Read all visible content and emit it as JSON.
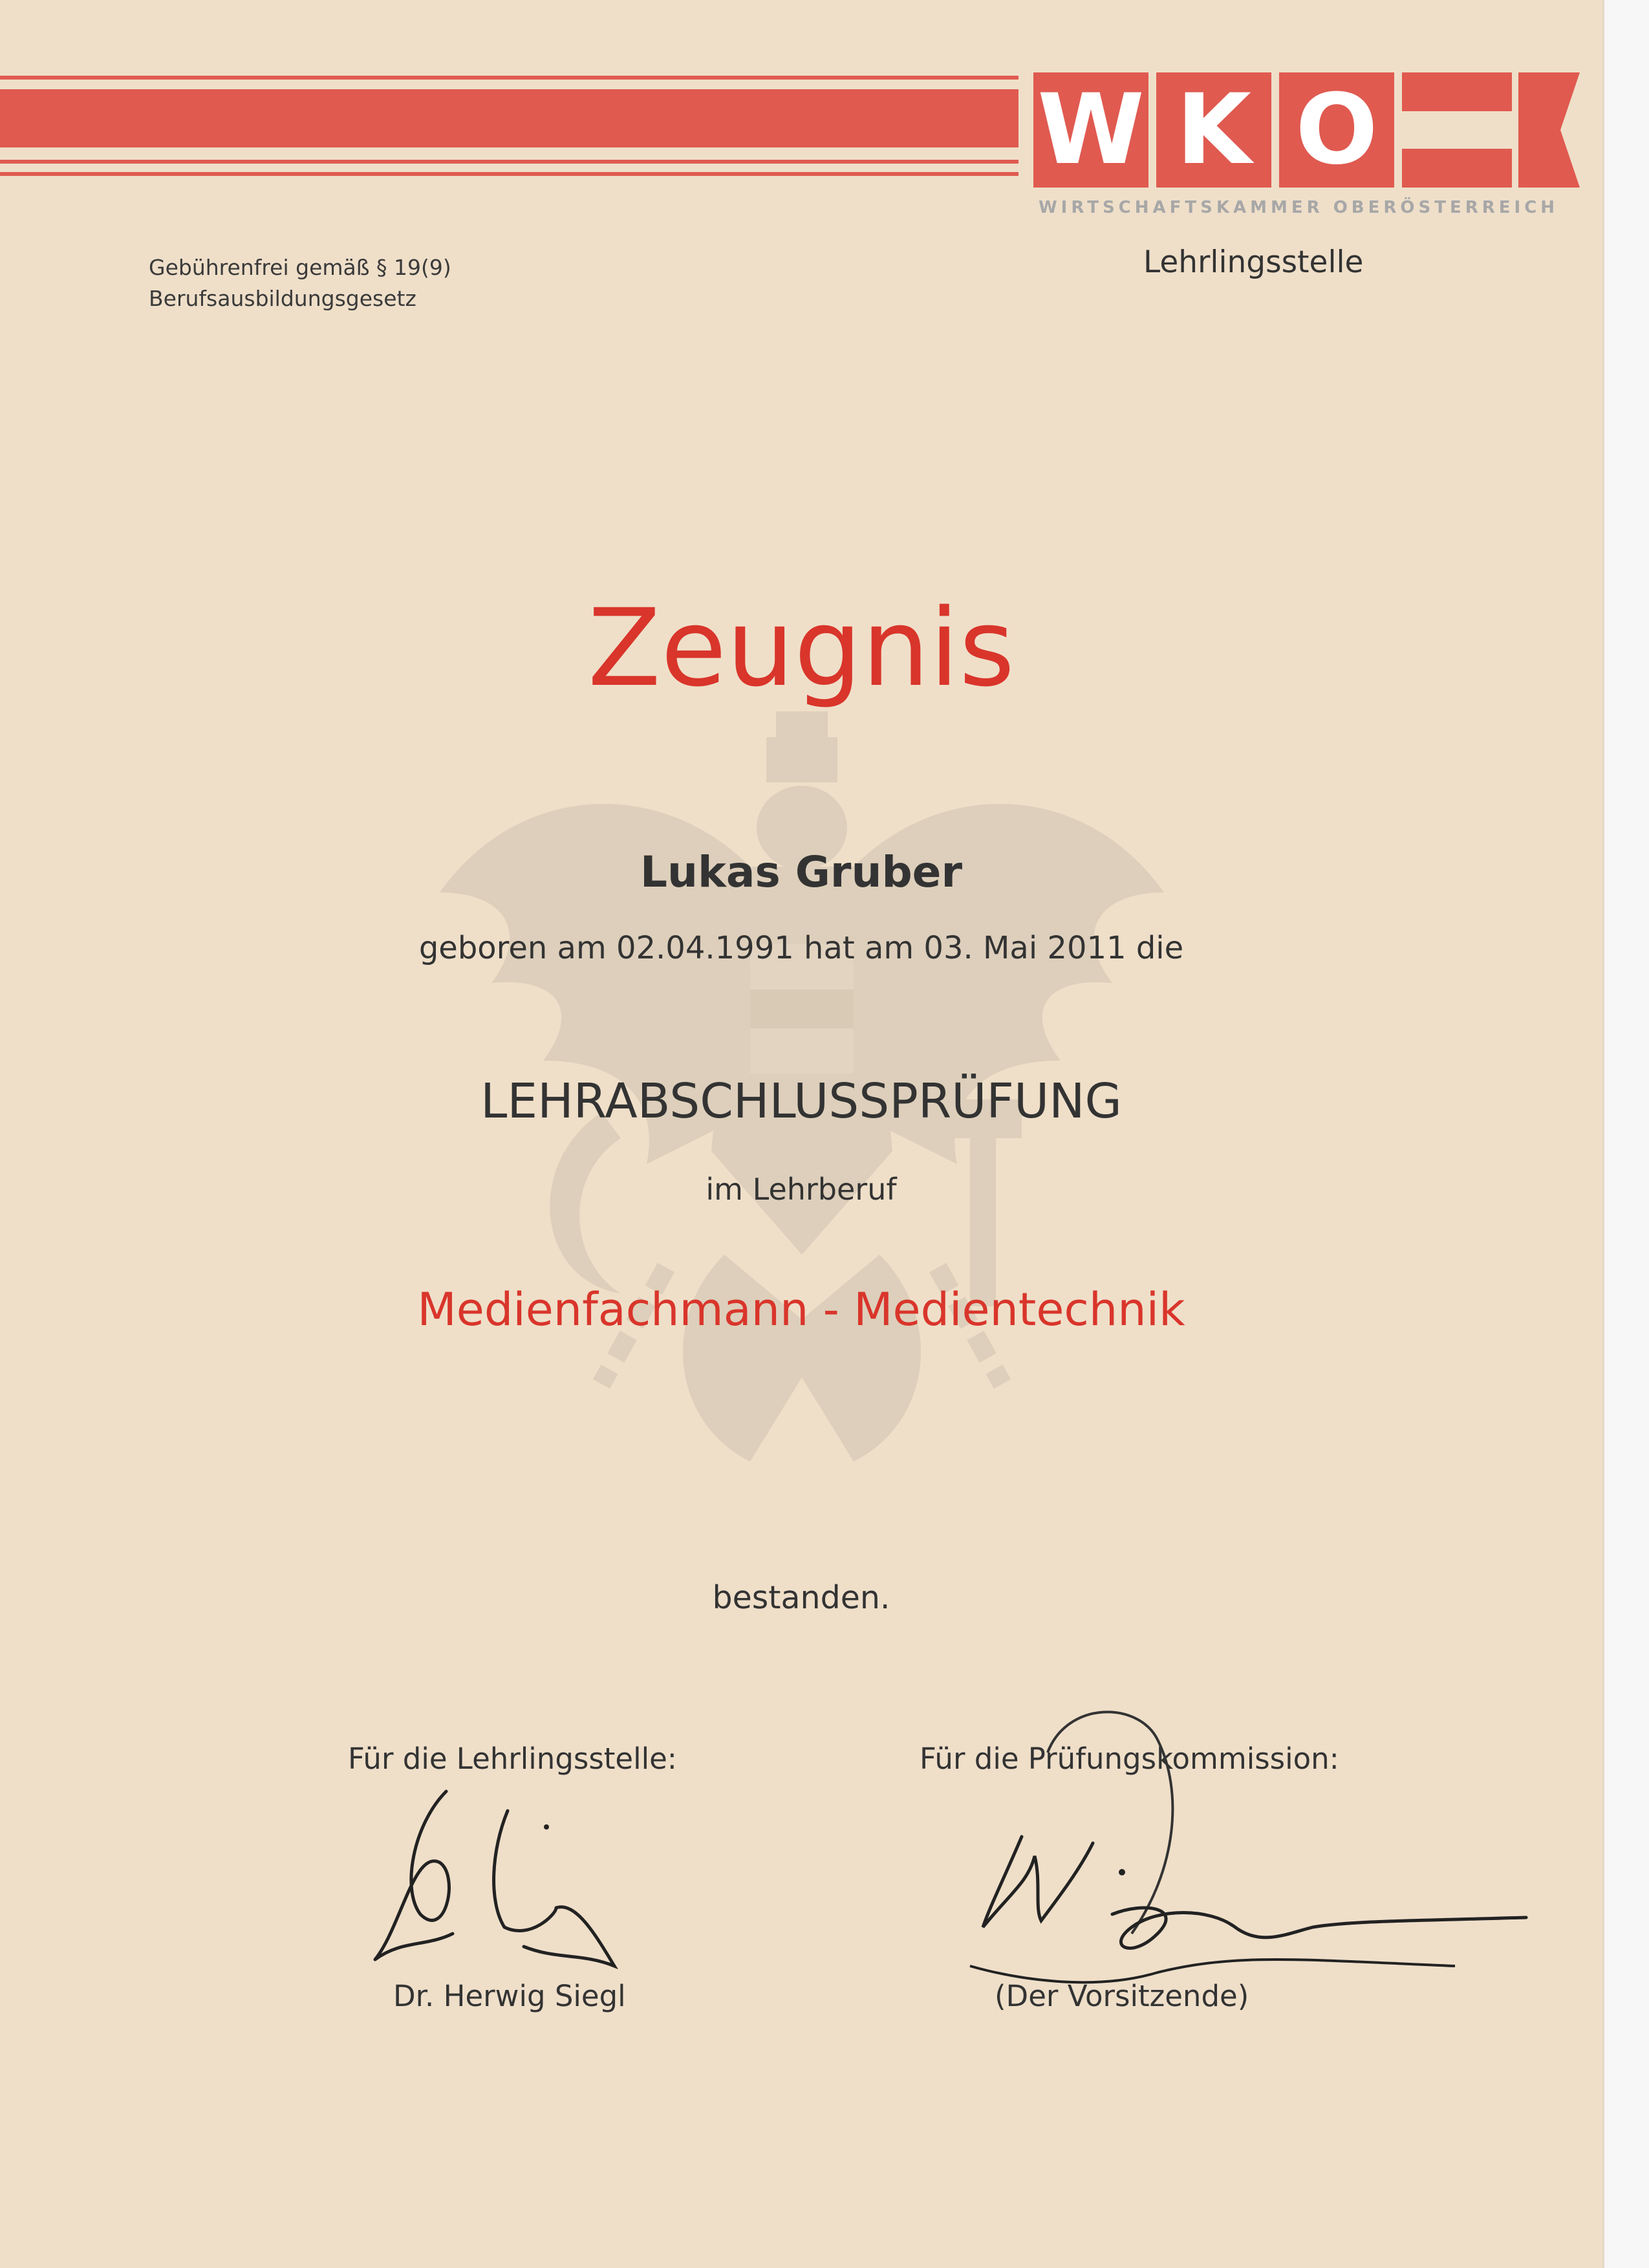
{
  "header": {
    "logo_letters": [
      "W",
      "K",
      "O"
    ],
    "logo_subtitle": "WIRTSCHAFTSKAMMER OBERÖSTERREICH",
    "brand_color": "#e05a50",
    "fee_line1": "Gebührenfrei gemäß § 19(9)",
    "fee_line2": "Berufsausbildungsgesetz",
    "office": "Lehrlingsstelle"
  },
  "certificate": {
    "title": "Zeugnis",
    "name": "Lukas Gruber",
    "born_line": "geboren am 02.04.1991 hat am 03. Mai 2011 die",
    "exam": "LEHRABSCHLUSSPRÜFUNG",
    "in_profession": "im Lehrberuf",
    "profession": "Medienfachmann - Medientechnik",
    "result": "bestanden.",
    "accent_color": "#d9352b"
  },
  "signatures": {
    "left_label": "Für die Lehrlingsstelle:",
    "left_name": "Dr. Herwig Siegl",
    "right_label": "Für die Prüfungskommission:",
    "right_name": "(Der Vorsitzende)"
  }
}
